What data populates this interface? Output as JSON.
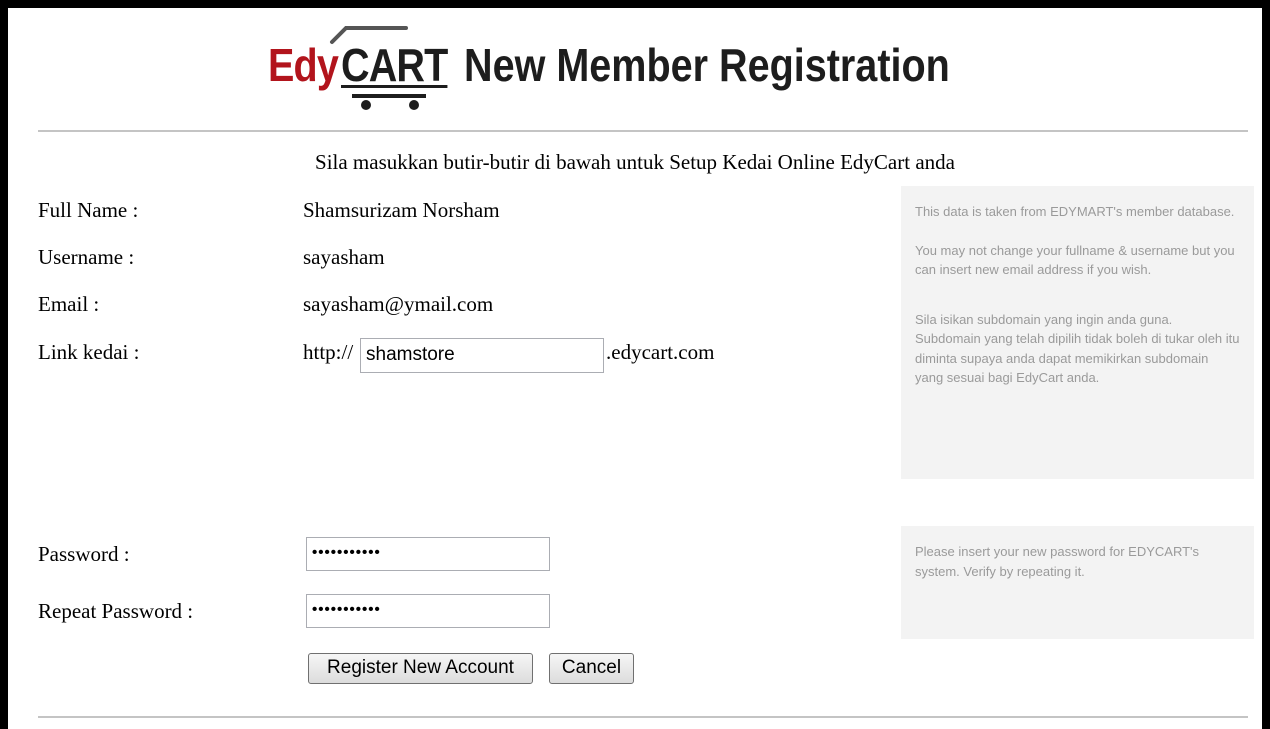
{
  "header": {
    "logo_edy": "Edy",
    "logo_cart": "CART",
    "title": "New Member Registration"
  },
  "intro": "Sila masukkan butir-butir di bawah untuk Setup Kedai Online EdyCart anda",
  "fields": {
    "fullname": {
      "label": "Full Name :",
      "value": "Shamsurizam Norsham"
    },
    "username": {
      "label": "Username :",
      "value": "sayasham"
    },
    "email": {
      "label": "Email :",
      "value": "sayasham@ymail.com"
    },
    "link": {
      "label": "Link kedai :",
      "prefix": "http://",
      "value": "shamstore",
      "suffix": ".edycart.com"
    },
    "password": {
      "label": "Password :",
      "value": "•••••••••••"
    },
    "repeat_password": {
      "label": "Repeat Password :",
      "value": "•••••••••••"
    }
  },
  "notes": {
    "account_p1": "This data is taken from EDYMART's member database.",
    "account_p2": "You may not change your fullname & username but you can insert new email address if you wish.",
    "account_p3": "Sila isikan subdomain yang ingin anda guna. Subdomain yang telah dipilih tidak boleh di tukar oleh itu diminta supaya anda dapat memikirkan subdomain yang sesuai bagi EdyCart anda.",
    "password": "Please insert your new password for EDYCART's system. Verify by repeating it."
  },
  "buttons": {
    "register": "Register New Account",
    "cancel": "Cancel"
  },
  "colors": {
    "brand_red": "#b2141c",
    "brand_dark": "#1d1d1d",
    "note_bg": "#f3f3f3",
    "note_text": "#9a9a9a"
  },
  "icons": {
    "logo_cart": "shopping-cart-icon"
  }
}
